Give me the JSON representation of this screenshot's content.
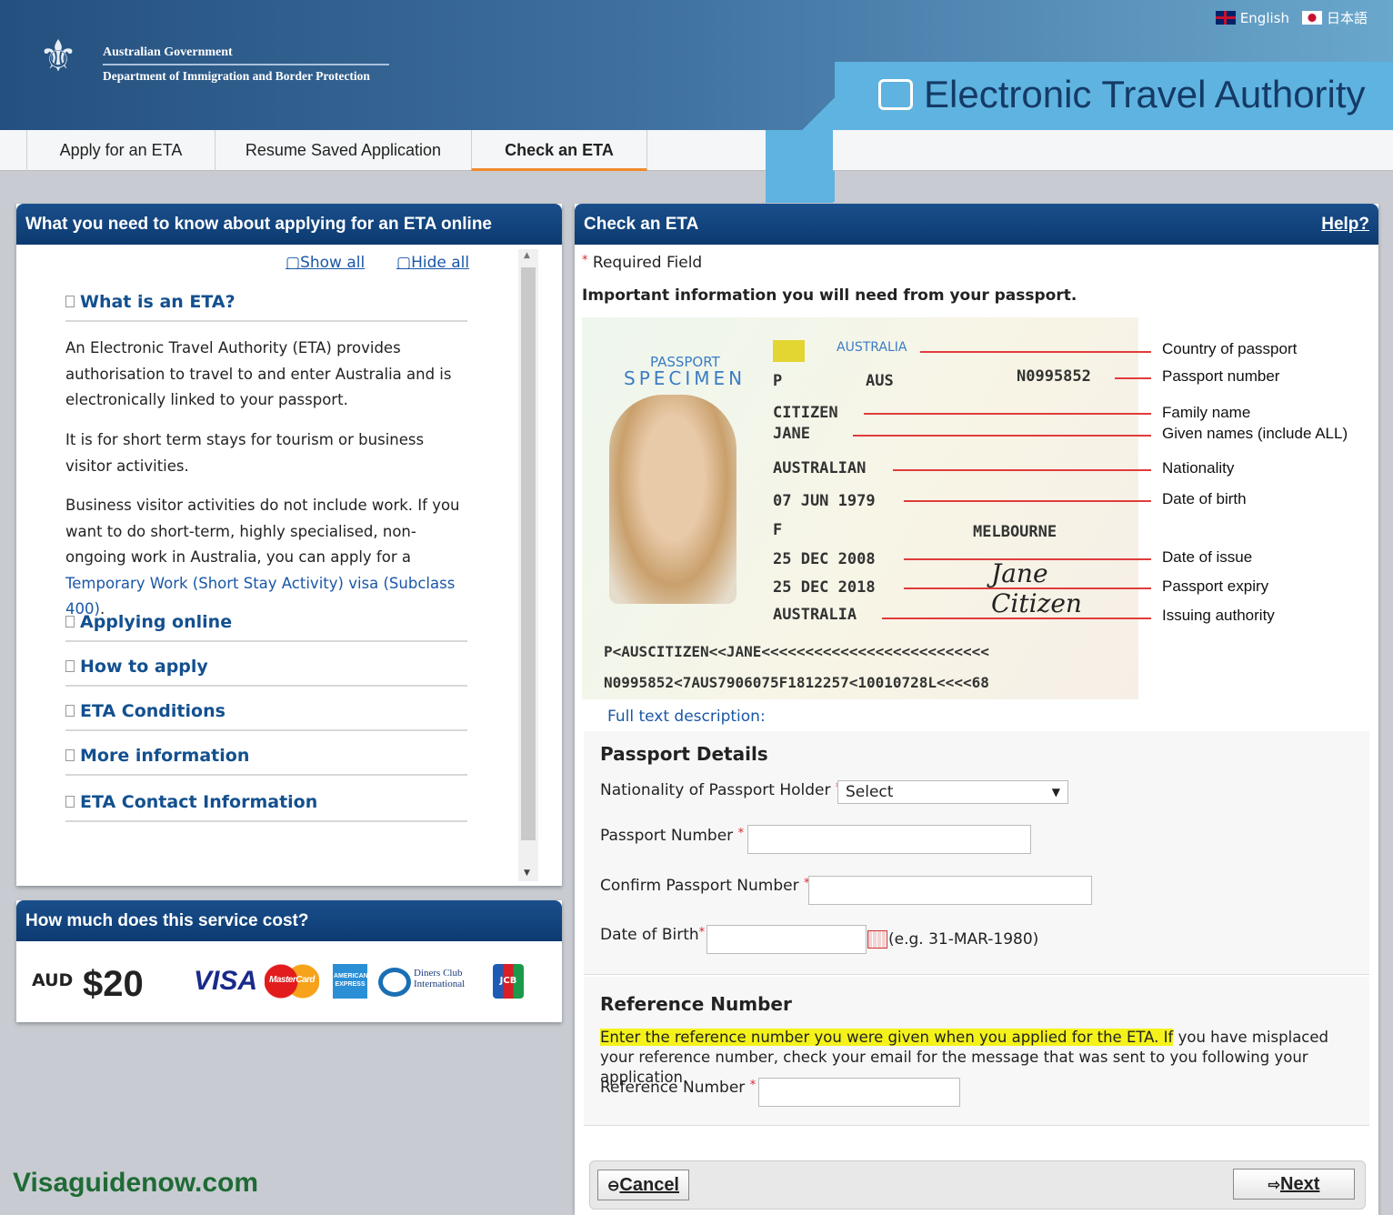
{
  "header": {
    "gov_name": "Australian Government",
    "department": "Department of Immigration and Border Protection",
    "app_title": "Electronic Travel Authority",
    "languages": [
      {
        "label": "English",
        "flag": "uk-flag-icon"
      },
      {
        "label": "日本語",
        "flag": "japan-flag-icon"
      }
    ]
  },
  "nav": {
    "tabs": [
      {
        "label": "Apply for an ETA"
      },
      {
        "label": "Resume Saved Application"
      },
      {
        "label": "Check an ETA",
        "active": true
      }
    ]
  },
  "info_panel": {
    "title": "What you need to know about applying for an ETA online",
    "show_all": "Show all",
    "hide_all": "Hide all",
    "sections": [
      {
        "title": "What is an ETA?",
        "expanded": true
      },
      {
        "title": "Applying online"
      },
      {
        "title": "How to apply"
      },
      {
        "title": "ETA Conditions"
      },
      {
        "title": "More information"
      },
      {
        "title": "ETA Contact Information"
      }
    ],
    "paragraphs": [
      "An Electronic Travel Authority (ETA) provides authorisation to travel to and enter Australia and is electronically linked to your passport.",
      "It is for short term stays for tourism or business visitor activities."
    ],
    "para3_text": "Business visitor activities do not include work. If you want to do short-term, highly specialised, non-ongoing work in Australia, you can apply for a ",
    "para3_link": "Temporary Work (Short Stay Activity) visa (Subclass 400)",
    "para3_end": "."
  },
  "cost_panel": {
    "title": "How much does this service cost?",
    "currency": "AUD",
    "price": "$20",
    "cards": [
      "VISA",
      "MasterCard",
      "American Express",
      "Diners Club International",
      "JCB"
    ]
  },
  "check_panel": {
    "title": "Check an ETA",
    "help": "Help?",
    "required_note": "Required Field",
    "important": "Important information you will need from your passport.",
    "passport_image": {
      "heading": "PASSPORT",
      "specimen": "SPECIMEN",
      "country": "AUSTRALIA",
      "type": "P",
      "code": "AUS",
      "doc_no": "N0995852",
      "surname": "CITIZEN",
      "given": "JANE",
      "nationality": "AUSTRALIAN",
      "dob": "07 JUN 1979",
      "sex": "F",
      "place": "MELBOURNE",
      "issue": "25 DEC 2008",
      "expiry": "25 DEC 2018",
      "authority": "AUSTRALIA",
      "signature": "Jane Citizen",
      "mrz1": "P<AUSCITIZEN<<JANE<<<<<<<<<<<<<<<<<<<<<<<<<<",
      "mrz2": "N0995852<7AUS7906075F1812257<10010728L<<<<68"
    },
    "callouts": [
      "Country of passport",
      "Passport number",
      "Family name",
      "Given names (include ALL)",
      "Nationality",
      "Date of birth",
      "Date of issue",
      "Passport expiry",
      "Issuing authority"
    ],
    "full_text": "Full text description:",
    "passport_details": {
      "title": "Passport Details",
      "nationality_label": "Nationality of Passport Holder",
      "nationality_value": "Select",
      "passport_label": "Passport Number",
      "confirm_label": "Confirm Passport Number",
      "dob_label": "Date of Birth",
      "dob_hint": "(e.g. 31-MAR-1980)"
    },
    "reference": {
      "title": "Reference Number",
      "highlight": "Enter the reference number you were given when you applied for the ETA. If",
      "rest": " you have misplaced your reference number, check your email for the message that was sent to you following your application.",
      "label": "Reference Number"
    },
    "cancel": "Cancel",
    "next": "Next"
  },
  "watermark": "Visaguidenow.com",
  "colors": {
    "header_dark": "#24507f",
    "panel_header": "#0c3a70",
    "accent_tab": "#f08a2c",
    "link": "#1a57a8",
    "required": "#d9272e",
    "highlight": "#f4f21a"
  }
}
